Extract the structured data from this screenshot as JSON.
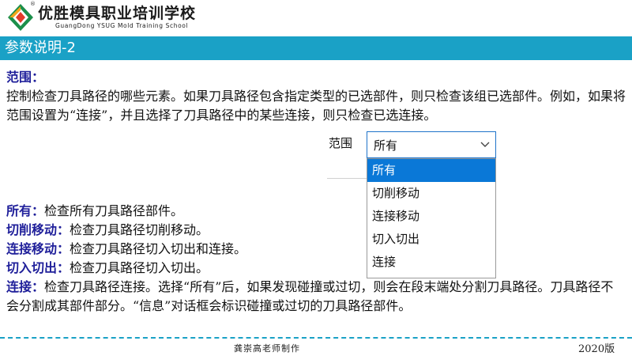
{
  "header": {
    "school_name": "优胜模具职业培训学校",
    "school_en": "GuangDong YSUG Mold Training School",
    "registered_mark": "®"
  },
  "title": "参数说明-2",
  "section": {
    "heading": "范围：",
    "description": "控制检查刀具路径的哪些元素。如果刀具路径包含指定类型的已选部件，则只检查该组已选部件。例如，如果将范围设置为“连接”，并且选择了刀具路径中的某些连接，则只检查已选连接。"
  },
  "ui": {
    "label": "范围",
    "selected": "所有",
    "options": [
      "所有",
      "切削移动",
      "连接移动",
      "切入切出",
      "连接"
    ]
  },
  "items": [
    {
      "term": "所有",
      "sep": "：",
      "text": "检查所有刀具路径部件。"
    },
    {
      "term": "切削移动",
      "sep": "：",
      "text": "检查刀具路径切削移动。"
    },
    {
      "term": "连接移动",
      "sep": "：",
      "text": "检查刀具路径切入切出和连接。"
    },
    {
      "term": "切入切出",
      "sep": "：",
      "text": "检查刀具路径切入切出。"
    },
    {
      "term": "连接",
      "sep": "：",
      "text": "检查刀具路径连接。选择“所有”后，如果发现碰撞或过切，则会在段末端处分割刀具路径。刀具路径不会分割成其部件部分。“信息”对话框会标识碰撞或过切的刀具路径部件。"
    }
  ],
  "footer": {
    "author": "龚崇高老师制作",
    "version": "2020版"
  },
  "colors": {
    "accent": "#1aa1c6",
    "keyword": "#1f1f9a",
    "selection": "#0a78d7"
  }
}
